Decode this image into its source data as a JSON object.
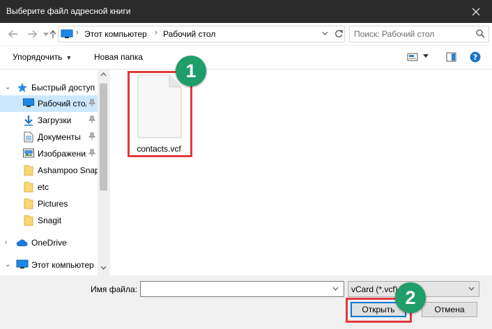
{
  "window": {
    "title": "Выберите файл адресной книги"
  },
  "address_bar": {
    "breadcrumbs": [
      "Этот компьютер",
      "Рабочий стол"
    ]
  },
  "search": {
    "placeholder": "Поиск: Рабочий стол"
  },
  "toolbar": {
    "organize_label": "Упорядочить",
    "new_folder_label": "Новая папка"
  },
  "nav_pane": {
    "items": [
      {
        "label": "Быстрый доступ",
        "icon": "star-icon"
      },
      {
        "label": "Рабочий стол",
        "icon": "desktop-icon",
        "pinned": true,
        "selected": true
      },
      {
        "label": "Загрузки",
        "icon": "download-icon",
        "pinned": true
      },
      {
        "label": "Документы",
        "icon": "document-icon",
        "pinned": true
      },
      {
        "label": "Изображения",
        "icon": "image-icon",
        "pinned": true
      },
      {
        "label": "Ashampoo Snap",
        "icon": "folder-icon"
      },
      {
        "label": "etc",
        "icon": "folder-icon"
      },
      {
        "label": "Pictures",
        "icon": "folder-icon"
      },
      {
        "label": "Snagit",
        "icon": "folder-icon"
      },
      {
        "label": "OneDrive",
        "icon": "cloud-icon"
      },
      {
        "label": "Этот компьютер",
        "icon": "computer-icon"
      }
    ]
  },
  "files": [
    {
      "name": "contacts.vcf",
      "icon": "file-icon"
    }
  ],
  "annotations": [
    {
      "number": "1"
    },
    {
      "number": "2"
    }
  ],
  "bottom": {
    "file_name_label": "Имя файла:",
    "file_name_value": "",
    "filter_value": "vCard (*.vcf)",
    "open_label": "Открыть",
    "cancel_label": "Отмена"
  },
  "colors": {
    "titlebar": "#2b2b2b",
    "selection": "#cce8ff",
    "highlight": "#e0393e",
    "badge": "#1f9e6a",
    "accent": "#0078d7"
  }
}
